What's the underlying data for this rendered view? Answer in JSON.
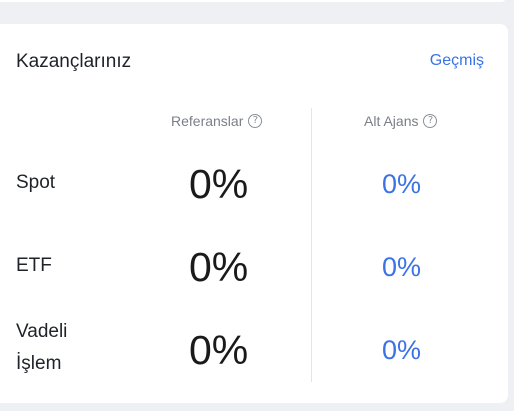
{
  "earnings": {
    "title": "Kazançlarınız",
    "history_link": "Geçmiş",
    "columns": {
      "referrals": "Referanslar",
      "sub_agency": "Alt Ajans"
    },
    "rows": [
      {
        "label": "Spot",
        "referrals_value": "0%",
        "sub_agency_value": "0%"
      },
      {
        "label": "ETF",
        "referrals_value": "0%",
        "sub_agency_value": "0%"
      },
      {
        "label": "Vadeli İşlem",
        "referrals_value": "0%",
        "sub_agency_value": "0%"
      }
    ],
    "help_glyph": "?"
  },
  "colors": {
    "accent": "#3b73e6",
    "text_primary": "#1f2329",
    "text_secondary": "#7a7f88",
    "page_background": "#eef0f4"
  },
  "icons": {
    "help": "question-circle-icon"
  }
}
